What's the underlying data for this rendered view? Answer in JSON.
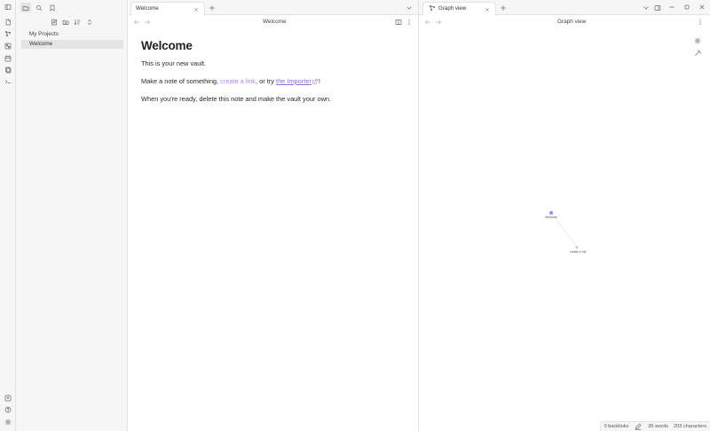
{
  "sidebar": {
    "folder": "My Projects",
    "file": "Welcome"
  },
  "left_pane": {
    "tab_title": "Welcome",
    "view_title": "Welcome",
    "note": {
      "heading": "Welcome",
      "line1": "This is your new vault.",
      "line2_a": "Make a note of something, ",
      "line2_link1": "create a link",
      "line2_b": ", or try ",
      "line2_link2": "the Importer",
      "line2_c": "!",
      "line3": "When you're ready, delete this note and make the vault your own."
    }
  },
  "right_pane": {
    "tab_title": "Graph view",
    "view_title": "Graph view",
    "graph": {
      "nodes": [
        {
          "label": "Welcome",
          "color": "#a882ff",
          "resolved": true
        },
        {
          "label": "create a link",
          "color": "#b8b8b8",
          "resolved": false
        }
      ]
    }
  },
  "statusbar": {
    "backlinks": "0 backlinks",
    "words": "35 words",
    "characters": "203 characters"
  },
  "colors": {
    "accent": "#8a5cf5",
    "link": "#a98ee0"
  }
}
